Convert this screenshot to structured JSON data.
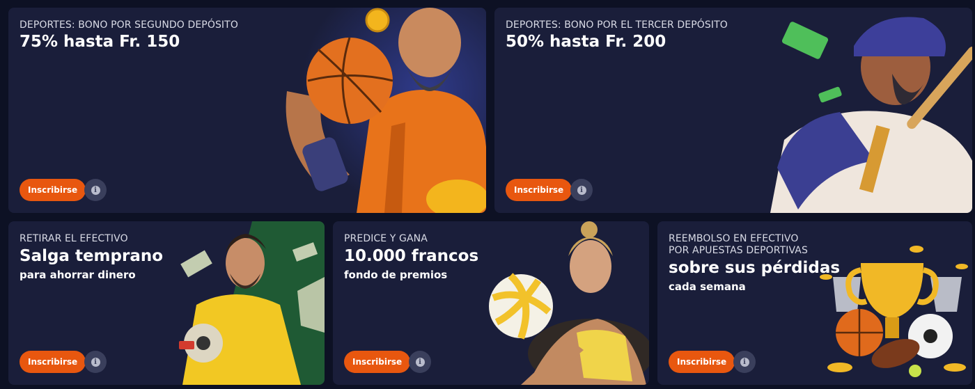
{
  "cards": [
    {
      "subtitle": "DEPORTES: BONO POR SEGUNDO DEPÓSITO",
      "title": "75% hasta Fr. 150",
      "button": "Inscribirse",
      "art": "basketball-player-illustration"
    },
    {
      "subtitle": "DEPORTES: BONO POR EL TERCER DEPÓSITO",
      "title": "50% hasta Fr. 200",
      "button": "Inscribirse",
      "art": "baseball-player-illustration"
    },
    {
      "subtitle": "RETIRAR EL EFECTIVO",
      "title": "Salga temprano",
      "desc": "para ahorrar dinero",
      "button": "Inscribirse",
      "art": "man-with-money-photo"
    },
    {
      "subtitle": "PREDICE Y GANA",
      "title": "10.000 francos",
      "desc": "fondo de premios",
      "button": "Inscribirse",
      "art": "volleyball-player-photo"
    },
    {
      "subtitle_line1": "REEMBOLSO EN EFECTIVO",
      "subtitle_line2": "POR APUESTAS DEPORTIVAS",
      "title": "sobre sus pérdidas",
      "desc": "cada semana",
      "button": "Inscribirse",
      "art": "trophy-and-balls-illustration"
    }
  ],
  "colors": {
    "page_bg": "#0d1124",
    "card_bg": "#1a1e3a",
    "button": "#e8570f",
    "info_button": "#3a3f5c"
  },
  "icons": {
    "info": "info-icon"
  }
}
